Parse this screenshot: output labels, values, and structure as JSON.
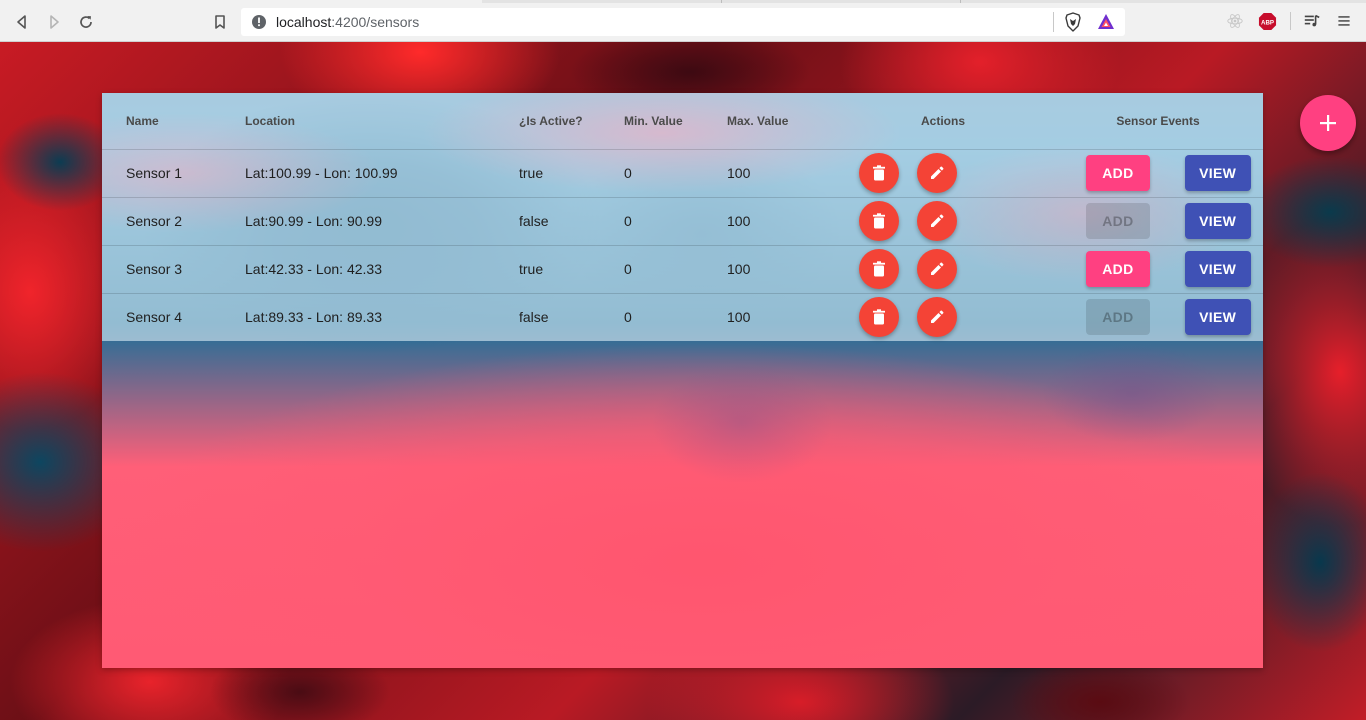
{
  "browser": {
    "url_host": "localhost",
    "url_path": ":4200/sensors",
    "extensions": [
      "react-devtools-icon",
      "adblock-plus-icon"
    ],
    "extension_label_abp": "ABP"
  },
  "table": {
    "headers": {
      "name": "Name",
      "location": "Location",
      "is_active": "¿Is Active?",
      "min_value": "Min. Value",
      "max_value": "Max. Value",
      "actions": "Actions",
      "sensor_events": "Sensor Events"
    },
    "rows": [
      {
        "name": "Sensor 1",
        "location": "Lat:100.99 - Lon: 100.99",
        "is_active": "true",
        "min": "0",
        "max": "100",
        "add_enabled": true
      },
      {
        "name": "Sensor 2",
        "location": "Lat:90.99 - Lon: 90.99",
        "is_active": "false",
        "min": "0",
        "max": "100",
        "add_enabled": false
      },
      {
        "name": "Sensor 3",
        "location": "Lat:42.33 - Lon: 42.33",
        "is_active": "true",
        "min": "0",
        "max": "100",
        "add_enabled": true
      },
      {
        "name": "Sensor 4",
        "location": "Lat:89.33 - Lon: 89.33",
        "is_active": "false",
        "min": "0",
        "max": "100",
        "add_enabled": false
      }
    ],
    "add_label": "ADD",
    "view_label": "VIEW"
  },
  "colors": {
    "accent": "#ff4081",
    "primary": "#3f51b5",
    "warn": "#f44336"
  }
}
